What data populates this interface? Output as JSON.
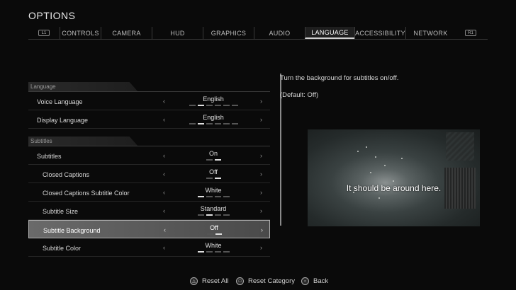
{
  "title": "OPTIONS",
  "tabbar": {
    "left_bumper": "L1",
    "right_bumper": "R1",
    "tabs": [
      {
        "label": "CONTROLS",
        "active": false
      },
      {
        "label": "CAMERA",
        "active": false
      },
      {
        "label": "HUD",
        "active": false
      },
      {
        "label": "GRAPHICS",
        "active": false
      },
      {
        "label": "AUDIO",
        "active": false
      },
      {
        "label": "LANGUAGE",
        "active": true
      },
      {
        "label": "ACCESSIBILITY",
        "active": false
      },
      {
        "label": "NETWORK",
        "active": false
      }
    ]
  },
  "sections": {
    "language": "Language",
    "subtitles": "Subtitles"
  },
  "rows": [
    {
      "label": "Voice Language",
      "value": "English",
      "option_index": 1,
      "option_count": 6
    },
    {
      "label": "Display Language",
      "value": "English",
      "option_index": 1,
      "option_count": 6
    },
    {
      "label": "Subtitles",
      "value": "On",
      "option_index": 1,
      "option_count": 2
    },
    {
      "label": "Closed Captions",
      "value": "Off",
      "option_index": 1,
      "option_count": 2
    },
    {
      "label": "Closed Captions Subtitle Color",
      "value": "White",
      "option_index": 0,
      "option_count": 4
    },
    {
      "label": "Subtitle Size",
      "value": "Standard",
      "option_index": 1,
      "option_count": 4
    },
    {
      "label": "Subtitle Background",
      "value": "Off",
      "option_index": 1,
      "option_count": 2,
      "selected": true
    },
    {
      "label": "Subtitle Color",
      "value": "White",
      "option_index": 0,
      "option_count": 4
    }
  ],
  "arrows": {
    "left": "‹",
    "right": "›"
  },
  "description": "Turn the background for subtitles on/off.",
  "default": "(Default: Off)",
  "preview_caption": "It should be around here.",
  "footer": {
    "reset_all": "Reset All",
    "reset_category": "Reset Category",
    "back": "Back"
  },
  "icons": {
    "triangle": "triangle-button-icon",
    "square": "square-button-icon",
    "circle": "circle-button-icon"
  }
}
